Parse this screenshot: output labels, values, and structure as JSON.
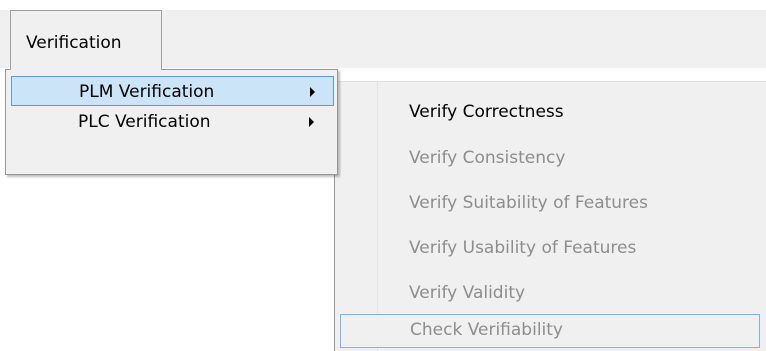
{
  "menubar": {
    "menu_label": "Verification"
  },
  "dropdown": {
    "items": [
      {
        "label": "PLM Verification",
        "selected": true
      },
      {
        "label": "PLC Verification",
        "selected": false
      }
    ]
  },
  "submenu": {
    "items": [
      {
        "label": "Verify Correctness",
        "enabled": true
      },
      {
        "label": "Verify Consistency",
        "enabled": false
      },
      {
        "label": "Verify Suitability of Features",
        "enabled": false
      },
      {
        "label": "Verify Usability of Features",
        "enabled": false
      },
      {
        "label": "Verify Validity",
        "enabled": false
      },
      {
        "label": "Check Verifiability",
        "enabled": false
      }
    ]
  },
  "colors": {
    "menu_background": "#f0f0f0",
    "selection_background": "#cce4f7",
    "selection_border": "#5c9bd3",
    "disabled_text": "#8d8d8d"
  }
}
